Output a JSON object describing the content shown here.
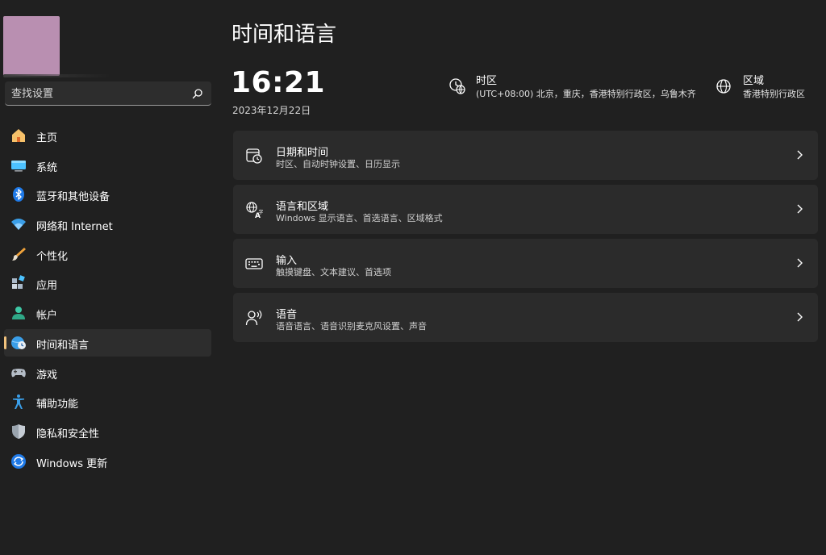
{
  "search": {
    "placeholder": "查找设置"
  },
  "sidebar": {
    "items": [
      {
        "label": "主页",
        "icon": "home-icon"
      },
      {
        "label": "系统",
        "icon": "system-monitor-icon"
      },
      {
        "label": "蓝牙和其他设备",
        "icon": "bluetooth-icon"
      },
      {
        "label": "网络和 Internet",
        "icon": "wifi-icon"
      },
      {
        "label": "个性化",
        "icon": "brush-icon"
      },
      {
        "label": "应用",
        "icon": "apps-icon"
      },
      {
        "label": "帐户",
        "icon": "account-icon"
      },
      {
        "label": "时间和语言",
        "icon": "globe-clock-icon",
        "selected": true
      },
      {
        "label": "游戏",
        "icon": "gamepad-icon"
      },
      {
        "label": "辅助功能",
        "icon": "accessibility-icon"
      },
      {
        "label": "隐私和安全性",
        "icon": "shield-icon"
      },
      {
        "label": "Windows 更新",
        "icon": "update-icon"
      }
    ]
  },
  "main": {
    "title": "时间和语言",
    "time": "16:21",
    "date": "2023年12月22日",
    "timezone": {
      "label": "时区",
      "value": "(UTC+08:00) 北京，重庆，香港特别行政区，乌鲁木齐",
      "icon": "timezone-icon"
    },
    "region": {
      "label": "区域",
      "value": "香港特别行政区",
      "icon": "globe-icon"
    },
    "cards": [
      {
        "title": "日期和时间",
        "subtitle": "时区、自动时钟设置、日历显示",
        "icon": "calendar-clock-icon"
      },
      {
        "title": "语言和区域",
        "subtitle": "Windows 显示语言、首选语言、区域格式",
        "icon": "language-icon"
      },
      {
        "title": "输入",
        "subtitle": "触摸键盘、文本建议、首选项",
        "icon": "keyboard-icon"
      },
      {
        "title": "语音",
        "subtitle": "语音语言、语音识别麦克风设置、声音",
        "icon": "speech-icon"
      }
    ]
  },
  "colors": {
    "background": "#202020",
    "card": "#2b2b2b",
    "selected_indicator": "#f1c27d",
    "avatar": "#b98fb1"
  }
}
